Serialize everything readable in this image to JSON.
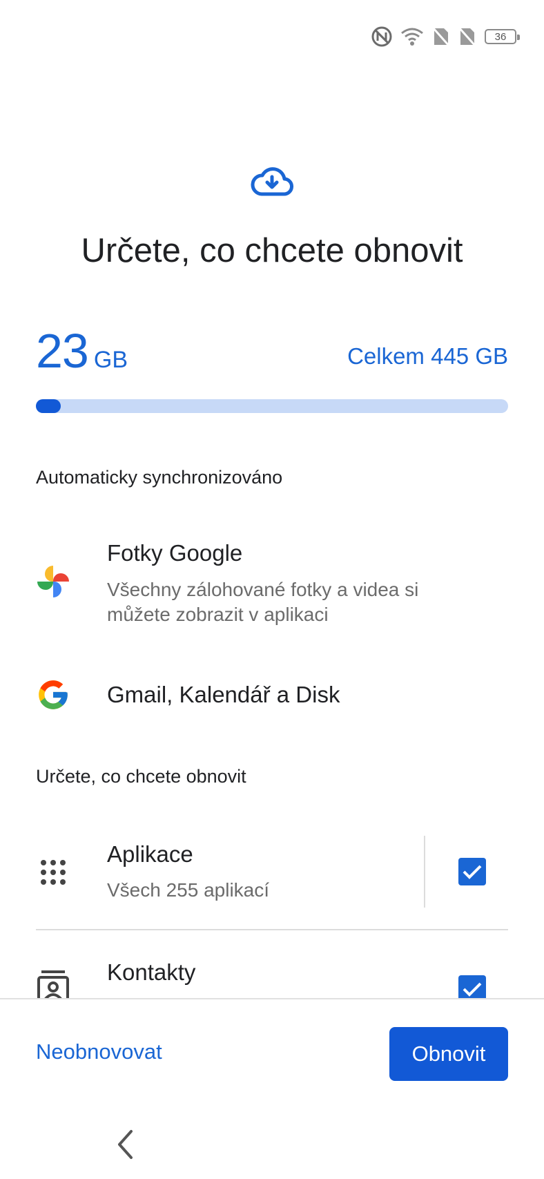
{
  "status_bar": {
    "battery_level": "36",
    "icons": [
      "nfc-icon",
      "wifi-icon",
      "no-sim-icon",
      "no-sim-icon"
    ]
  },
  "header": {
    "icon": "cloud-download-icon",
    "title": "Určete, co chcete obnovit"
  },
  "storage": {
    "used_value": "23",
    "used_unit": "GB",
    "total_label": "Celkem 445 GB",
    "used_fraction": 0.052
  },
  "auto_sync": {
    "section_label": "Automaticky synchronizováno",
    "items": [
      {
        "icon": "google-photos-icon",
        "title": "Fotky Google",
        "subtitle": "Všechny zálohované fotky a videa si můžete zobrazit v aplikaci"
      },
      {
        "icon": "google-icon",
        "title": "Gmail, Kalendář a Disk"
      }
    ]
  },
  "choose": {
    "section_label": "Určete, co chcete obnovit",
    "items": [
      {
        "icon": "apps-grid-icon",
        "title": "Aplikace",
        "subtitle": "Všech 255 aplikací",
        "checked": true
      },
      {
        "icon": "contacts-icon",
        "title": "Kontakty",
        "checked": true
      }
    ]
  },
  "footer": {
    "skip_label": "Neobnovovat",
    "restore_label": "Obnovit"
  },
  "nav": {
    "icon": "back-chevron-icon"
  },
  "colors": {
    "accent": "#1a66d4",
    "button": "#1259d6",
    "track": "#c7d9f7"
  }
}
